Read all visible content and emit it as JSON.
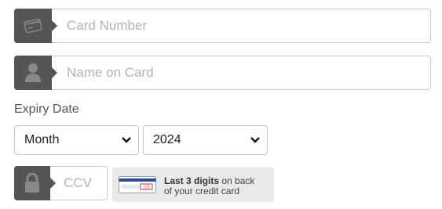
{
  "card_number": {
    "placeholder": "Card Number",
    "value": ""
  },
  "name_on_card": {
    "placeholder": "Name on Card",
    "value": ""
  },
  "expiry": {
    "label": "Expiry Date",
    "month": {
      "selected": "Month"
    },
    "year": {
      "selected": "2024"
    }
  },
  "ccv": {
    "placeholder": "CCV",
    "value": ""
  },
  "ccv_hint": {
    "bold": "Last 3 digits",
    "rest_line1": " on back",
    "line2": "of your credit card",
    "card_number_text": "123"
  },
  "icons": {
    "card": "credit-card-icon",
    "person": "user-icon",
    "lock": "lock-icon",
    "chevron": "chevron-down-icon"
  },
  "colors": {
    "icon_bg": "#555555",
    "border": "#c9c9c9",
    "placeholder": "#b3b3b3",
    "hint_bg": "#e9e9e9"
  }
}
